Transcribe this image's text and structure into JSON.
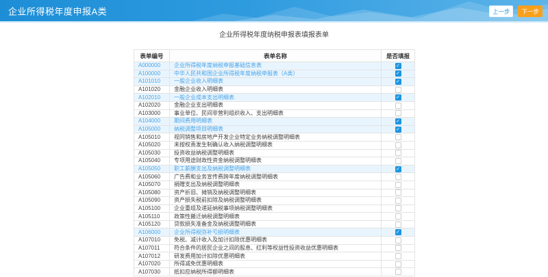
{
  "banner": {
    "title": "企业所得税年度申报A类",
    "prev_label": "上一步",
    "next_label": "下一步"
  },
  "page": {
    "title": "企业所得税年度纳税申报表填报表单"
  },
  "table": {
    "headers": [
      "表单编号",
      "表单名称",
      "是否填报"
    ],
    "rows": [
      {
        "code": "A000000",
        "name": "企业所得税年度纳税申报基础信息表",
        "checked": true
      },
      {
        "code": "A100000",
        "name": "中华人民共和国企业所得税年度纳税申报表（A类）",
        "checked": true
      },
      {
        "code": "A101010",
        "name": "一般企业收入明细表",
        "checked": true
      },
      {
        "code": "A101020",
        "name": "金融企业收入明细表",
        "checked": false
      },
      {
        "code": "A102010",
        "name": "一般企业成本支出明细表",
        "checked": true
      },
      {
        "code": "A102020",
        "name": "金融企业支出明细表",
        "checked": false
      },
      {
        "code": "A103000",
        "name": "事业单位、民间非营利组织收入、支出明细表",
        "checked": false
      },
      {
        "code": "A104000",
        "name": "期间费用明细表",
        "checked": true
      },
      {
        "code": "A105000",
        "name": "纳税调整项目明细表",
        "checked": true
      },
      {
        "code": "A105010",
        "name": "视同销售和房地产开发企业特定业务纳税调整明细表",
        "checked": false
      },
      {
        "code": "A105020",
        "name": "未按权责发生制确认收入纳税调整明细表",
        "checked": false
      },
      {
        "code": "A105030",
        "name": "投资收益纳税调整明细表",
        "checked": false
      },
      {
        "code": "A105040",
        "name": "专项用途财政性资金纳税调整明细表",
        "checked": false
      },
      {
        "code": "A105050",
        "name": "职工薪酬支出及纳税调整明细表",
        "checked": true
      },
      {
        "code": "A105060",
        "name": "广告费和业务宣传费跨年度纳税调整明细表",
        "checked": false
      },
      {
        "code": "A105070",
        "name": "捐赠支出及纳税调整明细表",
        "checked": false
      },
      {
        "code": "A105080",
        "name": "资产折旧、摊销及纳税调整明细表",
        "checked": false
      },
      {
        "code": "A105090",
        "name": "资产损失税前扣除及纳税调整明细表",
        "checked": false
      },
      {
        "code": "A105100",
        "name": "企业重组及递延纳税事项纳税调整明细表",
        "checked": false
      },
      {
        "code": "A105110",
        "name": "政策性搬迁纳税调整明细表",
        "checked": false
      },
      {
        "code": "A105120",
        "name": "贷款损失准备金及纳税调整明细表",
        "checked": false
      },
      {
        "code": "A106000",
        "name": "企业所得税弥补亏损明细表",
        "checked": true
      },
      {
        "code": "A107010",
        "name": "免税、减计收入及加计扣除优惠明细表",
        "checked": false
      },
      {
        "code": "A107011",
        "name": "符合条件的居民企业之间的股息、红利等权益性投资收益优惠明细表",
        "checked": false
      },
      {
        "code": "A107012",
        "name": "研发费用加计扣除优惠明细表",
        "checked": false
      },
      {
        "code": "A107020",
        "name": "所得减免优惠明细表",
        "checked": false
      },
      {
        "code": "A107030",
        "name": "抵扣应纳税所得额明细表",
        "checked": false
      }
    ]
  },
  "colors": {
    "banner_blue": "#2f9bdf",
    "accent_orange": "#f9a01b",
    "link_blue": "#4aa4e6",
    "row_highlight": "#e9f5fe",
    "checkbox_checked": "#1e95e0"
  }
}
